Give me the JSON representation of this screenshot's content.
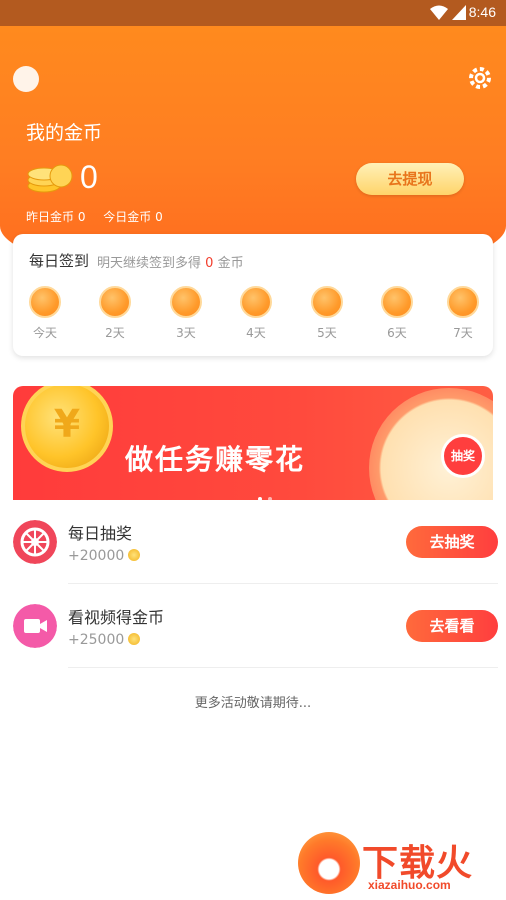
{
  "status_bar": {
    "time": "8:46"
  },
  "header": {
    "title": "我的金币",
    "coin_count": "0",
    "withdraw_label": "去提现",
    "yesterday": "昨日金币 0",
    "today": "今日金币 0"
  },
  "signin": {
    "title": "每日签到",
    "subtitle_prefix": "明天继续签到多得",
    "subtitle_num": "0",
    "subtitle_suffix": "金币",
    "days": [
      "今天",
      "2天",
      "3天",
      "4天",
      "5天",
      "6天",
      "7天"
    ]
  },
  "banner": {
    "text": "做任务赚零花",
    "wheel_label": "抽奖",
    "coin_symbol": "¥"
  },
  "tasks": [
    {
      "name": "每日抽奖",
      "reward": "+20000",
      "button": "去抽奖",
      "icon": "wheel-icon",
      "color": "#f0465a"
    },
    {
      "name": "看视频得金币",
      "reward": "+25000",
      "button": "去看看",
      "icon": "video-icon",
      "color": "#f45aa8"
    }
  ],
  "more_text": "更多活动敬请期待...",
  "watermark": {
    "brand": "下载火",
    "url": "xiazaihuo.com"
  },
  "colors": {
    "header_orange": "#ff7d22",
    "accent_red": "#ff3e3e",
    "withdraw_text": "#e8751c"
  }
}
